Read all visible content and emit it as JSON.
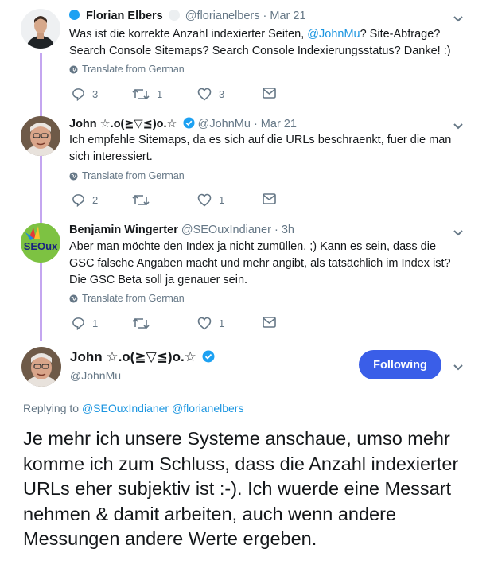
{
  "tweets": [
    {
      "name": "Florian Elbers",
      "handle": "@florianelbers",
      "date": "· Mar 21",
      "text_before": "Was ist die korrekte Anzahl indexierter Seiten, ",
      "mention": "@JohnMu",
      "text_after": "? Site-Abfrage? Search Console Sitemaps? Search Console Indexierungsstatus? Danke! :)",
      "translate": "Translate from German",
      "replies": "3",
      "retweets": "1",
      "likes": "3"
    },
    {
      "name": "John ☆.o(≧▽≦)o.☆",
      "handle": "@JohnMu",
      "date": "· Mar 21",
      "text": "Ich empfehle Sitemaps, da es sich auf die URLs beschraenkt, fuer die man sich interessiert.",
      "translate": "Translate from German",
      "replies": "2",
      "retweets": "",
      "likes": "1"
    },
    {
      "name": "Benjamin Wingerter",
      "handle": "@SEOuxIndianer",
      "date": "· 3h",
      "avatar_text": "SEOux",
      "text": "Aber man möchte den Index ja nicht zumüllen. ;) Kann es sein, dass die GSC falsche Angaben macht und mehr angibt, als tatsächlich im Index ist? Die GSC Beta soll ja genauer sein.",
      "translate": "Translate from German",
      "replies": "1",
      "retweets": "",
      "likes": "1"
    }
  ],
  "main_tweet": {
    "name": "John ☆.o(≧▽≦)o.☆",
    "handle": "@JohnMu",
    "follow_label": "Following",
    "replying_label": "Replying to",
    "replying_mentions": "@SEOuxIndianer @florianelbers",
    "text": "Je mehr ich unsere Systeme anschaue, umso mehr komme ich zum Schluss, dass die Anzahl indexierter URLs eher subjektiv ist :-). Ich wuerde eine Messart nehmen & damit arbeiten, auch wenn andere Messungen andere Werte ergeben."
  },
  "colors": {
    "accent": "#1da1f2",
    "follow_button": "#3a5ee8",
    "thread_line": "#c4a6f0",
    "muted": "#657786"
  },
  "icons": [
    "reply-icon",
    "retweet-icon",
    "like-icon",
    "dm-icon",
    "globe-icon",
    "chevron-down-icon",
    "verified-icon"
  ]
}
